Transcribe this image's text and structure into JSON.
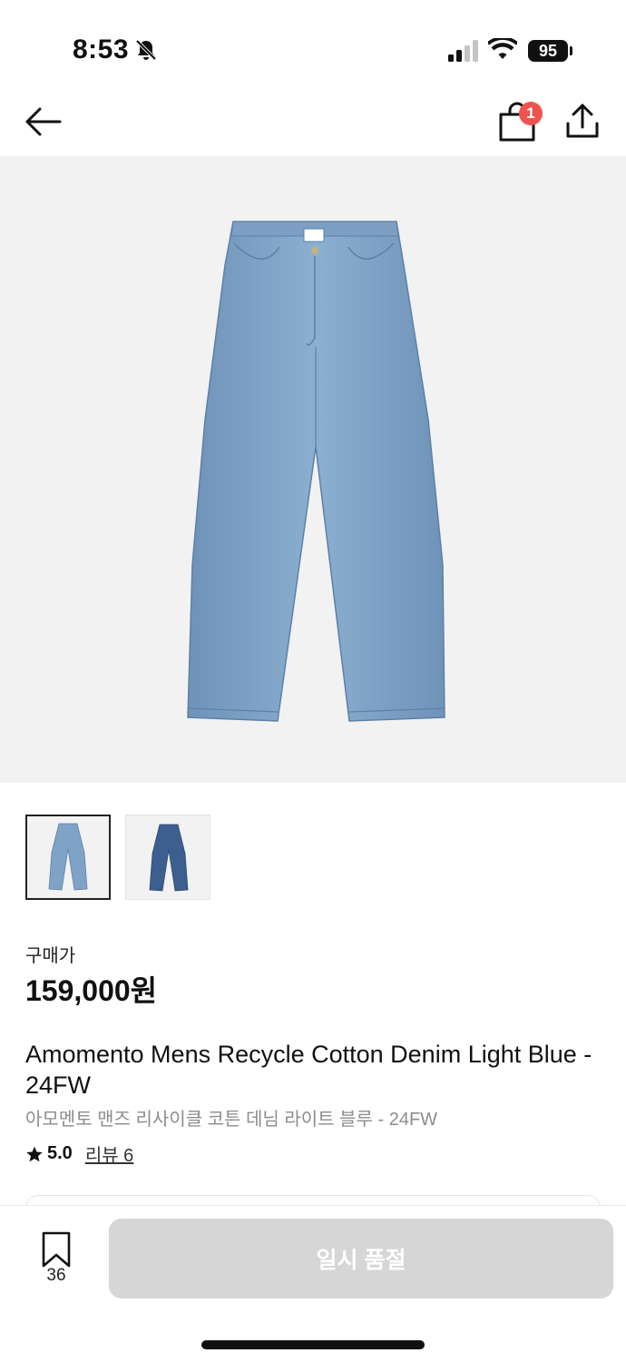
{
  "status_bar": {
    "time": "8:53",
    "battery": "95"
  },
  "nav": {
    "cart_badge": "1"
  },
  "product": {
    "price_label": "구매가",
    "price": "159,000원",
    "title": "Amomento Mens Recycle Cotton Denim Light Blue - 24FW",
    "subtitle": "아모멘토 맨즈 리사이클 코튼 데님 라이트 블루 - 24FW",
    "rating": "5.0",
    "review_link": "리뷰 6"
  },
  "thumbnails": [
    {
      "name": "light-blue",
      "selected": true,
      "color": "#7fa3c6"
    },
    {
      "name": "dark-blue",
      "selected": false,
      "color": "#3d5f8f"
    }
  ],
  "bottom_bar": {
    "bookmark_count": "36",
    "buy_label": "일시 품절"
  },
  "colors": {
    "badge": "#ef5350",
    "disabled_button": "#d6d6d6",
    "hero_bg": "#f2f2f2",
    "denim_light": "#7fa3c6"
  }
}
